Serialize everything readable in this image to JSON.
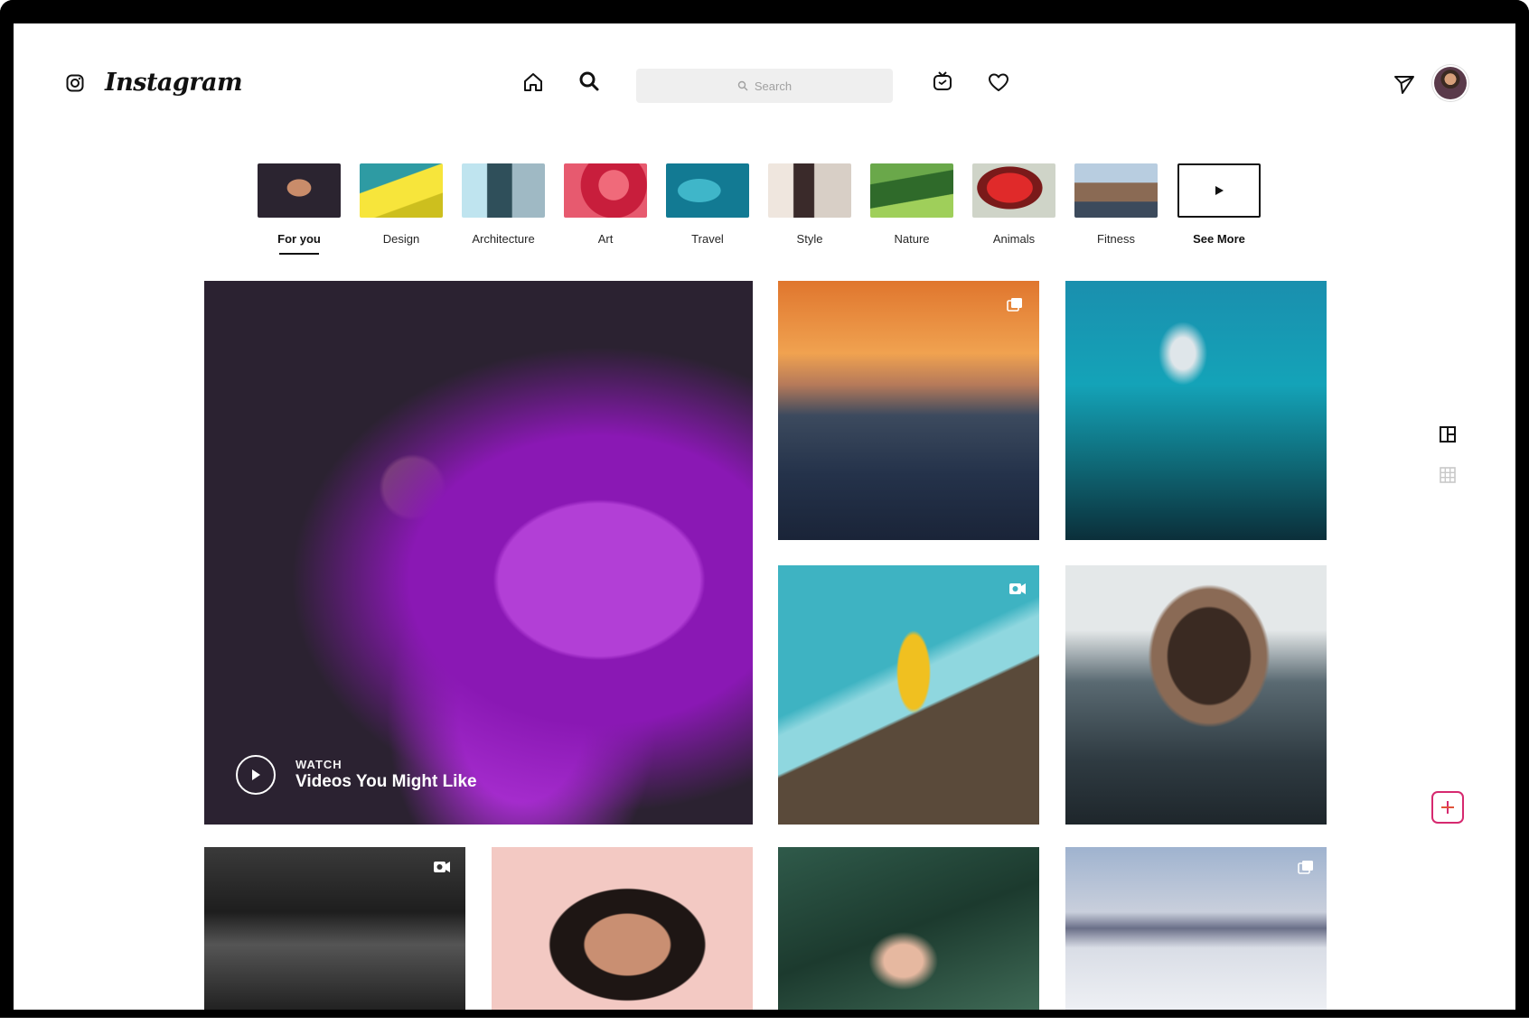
{
  "app": {
    "name": "Instagram",
    "search_placeholder": "Search"
  },
  "header": {
    "icons": [
      "instagram-glyph-icon",
      "home-icon",
      "search-icon",
      "igtv-icon",
      "heart-icon",
      "direct-send-icon"
    ]
  },
  "categories": [
    {
      "label": "For you",
      "active": true
    },
    {
      "label": "Design",
      "active": false
    },
    {
      "label": "Architecture",
      "active": false
    },
    {
      "label": "Art",
      "active": false
    },
    {
      "label": "Travel",
      "active": false
    },
    {
      "label": "Style",
      "active": false
    },
    {
      "label": "Nature",
      "active": false
    },
    {
      "label": "Animals",
      "active": false
    },
    {
      "label": "Fitness",
      "active": false
    },
    {
      "label": "See More",
      "active": false
    }
  ],
  "feature": {
    "kicker": "WATCH",
    "title": "Videos You Might Like"
  },
  "tiles": [
    {
      "name": "mountain-sunset",
      "badge": "carousel-icon"
    },
    {
      "name": "polar-bear-aquarium",
      "badge": "none"
    },
    {
      "name": "skater-ramp",
      "badge": "video-icon"
    },
    {
      "name": "face-in-water",
      "badge": "none"
    },
    {
      "name": "band-bw",
      "badge": "video-icon"
    },
    {
      "name": "woman-portrait",
      "badge": "none"
    },
    {
      "name": "woman-palms",
      "badge": "none"
    },
    {
      "name": "clouds-peaks",
      "badge": "carousel-icon"
    }
  ],
  "colors": {
    "accent_gradient_start": "#f58529",
    "accent_gradient_end": "#dd2a7b",
    "text": "#262626",
    "search_bg": "#efefef"
  }
}
